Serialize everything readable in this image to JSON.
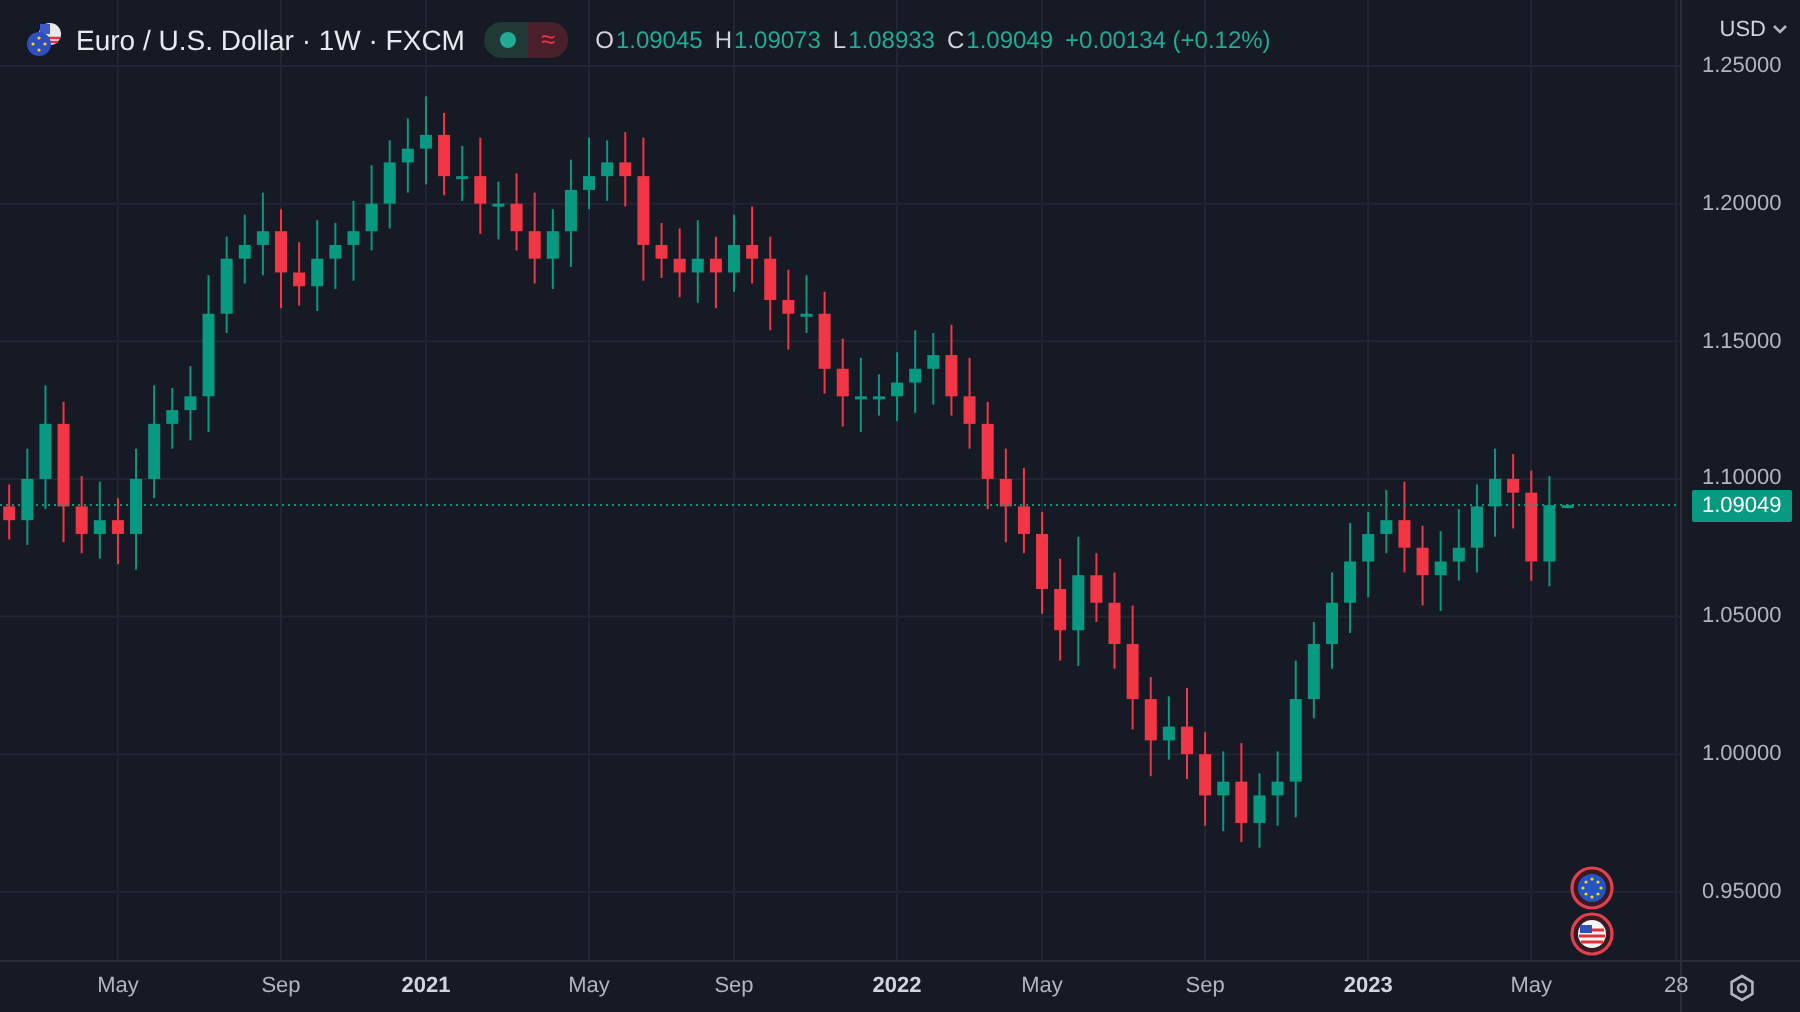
{
  "legend": {
    "symbol": "Euro / U.S. Dollar · 1W · FXCM",
    "status_badge": {
      "market_open": true,
      "symbol": "≈"
    },
    "ohlc": [
      {
        "label": "O",
        "value": "1.09045"
      },
      {
        "label": "H",
        "value": "1.09073"
      },
      {
        "label": "L",
        "value": "1.08933"
      },
      {
        "label": "C",
        "value": "1.09049"
      }
    ],
    "change": "+0.00134 (+0.12%)"
  },
  "price_axis": {
    "currency": "USD",
    "last_price": "1.09049"
  },
  "event_markers": [
    {
      "kind": "eu"
    },
    {
      "kind": "us"
    }
  ],
  "chart_data": {
    "type": "candlestick",
    "categories": [
      null,
      null,
      null,
      null,
      null,
      null,
      "May",
      null,
      null,
      null,
      null,
      null,
      null,
      null,
      null,
      "Sep",
      null,
      null,
      null,
      null,
      null,
      null,
      null,
      "2021",
      null,
      null,
      null,
      null,
      null,
      null,
      null,
      null,
      "May",
      null,
      null,
      null,
      null,
      null,
      null,
      null,
      "Sep",
      null,
      null,
      null,
      null,
      null,
      null,
      null,
      null,
      "2022",
      null,
      null,
      null,
      null,
      null,
      null,
      null,
      "May",
      null,
      null,
      null,
      null,
      null,
      null,
      null,
      null,
      "Sep",
      null,
      null,
      null,
      null,
      null,
      null,
      null,
      null,
      "2023",
      null,
      null,
      null,
      null,
      null,
      null,
      null,
      null,
      "May",
      null,
      null,
      null,
      null,
      null,
      null,
      null,
      "28"
    ],
    "ohlc": [
      [
        1.09,
        1.098,
        1.078,
        1.085
      ],
      [
        1.085,
        1.111,
        1.076,
        1.1
      ],
      [
        1.1,
        1.134,
        1.089,
        1.12
      ],
      [
        1.12,
        1.128,
        1.077,
        1.09
      ],
      [
        1.09,
        1.101,
        1.073,
        1.08
      ],
      [
        1.08,
        1.099,
        1.071,
        1.085
      ],
      [
        1.085,
        1.093,
        1.069,
        1.08
      ],
      [
        1.08,
        1.111,
        1.067,
        1.1
      ],
      [
        1.1,
        1.134,
        1.093,
        1.12
      ],
      [
        1.12,
        1.133,
        1.111,
        1.125
      ],
      [
        1.125,
        1.141,
        1.114,
        1.13
      ],
      [
        1.13,
        1.174,
        1.117,
        1.16
      ],
      [
        1.16,
        1.188,
        1.153,
        1.18
      ],
      [
        1.18,
        1.196,
        1.171,
        1.185
      ],
      [
        1.185,
        1.204,
        1.174,
        1.19
      ],
      [
        1.19,
        1.198,
        1.162,
        1.175
      ],
      [
        1.175,
        1.186,
        1.163,
        1.17
      ],
      [
        1.17,
        1.194,
        1.161,
        1.18
      ],
      [
        1.18,
        1.193,
        1.169,
        1.185
      ],
      [
        1.185,
        1.201,
        1.172,
        1.19
      ],
      [
        1.19,
        1.214,
        1.183,
        1.2
      ],
      [
        1.2,
        1.223,
        1.191,
        1.215
      ],
      [
        1.215,
        1.231,
        1.204,
        1.22
      ],
      [
        1.22,
        1.239,
        1.207,
        1.225
      ],
      [
        1.225,
        1.233,
        1.203,
        1.21
      ],
      [
        1.21,
        1.221,
        1.201,
        1.21
      ],
      [
        1.21,
        1.224,
        1.189,
        1.2
      ],
      [
        1.2,
        1.208,
        1.187,
        1.2
      ],
      [
        1.2,
        1.211,
        1.183,
        1.19
      ],
      [
        1.19,
        1.204,
        1.171,
        1.18
      ],
      [
        1.18,
        1.198,
        1.169,
        1.19
      ],
      [
        1.19,
        1.216,
        1.177,
        1.205
      ],
      [
        1.205,
        1.224,
        1.198,
        1.21
      ],
      [
        1.21,
        1.223,
        1.201,
        1.215
      ],
      [
        1.215,
        1.226,
        1.199,
        1.21
      ],
      [
        1.21,
        1.224,
        1.172,
        1.185
      ],
      [
        1.185,
        1.193,
        1.173,
        1.18
      ],
      [
        1.18,
        1.191,
        1.166,
        1.175
      ],
      [
        1.175,
        1.194,
        1.164,
        1.18
      ],
      [
        1.18,
        1.188,
        1.162,
        1.175
      ],
      [
        1.175,
        1.196,
        1.168,
        1.185
      ],
      [
        1.185,
        1.199,
        1.171,
        1.18
      ],
      [
        1.18,
        1.188,
        1.154,
        1.165
      ],
      [
        1.165,
        1.176,
        1.147,
        1.16
      ],
      [
        1.16,
        1.174,
        1.153,
        1.16
      ],
      [
        1.16,
        1.168,
        1.131,
        1.14
      ],
      [
        1.14,
        1.151,
        1.119,
        1.13
      ],
      [
        1.13,
        1.144,
        1.117,
        1.13
      ],
      [
        1.13,
        1.138,
        1.123,
        1.13
      ],
      [
        1.13,
        1.146,
        1.121,
        1.135
      ],
      [
        1.135,
        1.154,
        1.124,
        1.14
      ],
      [
        1.14,
        1.153,
        1.127,
        1.145
      ],
      [
        1.145,
        1.156,
        1.123,
        1.13
      ],
      [
        1.13,
        1.144,
        1.111,
        1.12
      ],
      [
        1.12,
        1.128,
        1.089,
        1.1
      ],
      [
        1.1,
        1.111,
        1.077,
        1.09
      ],
      [
        1.09,
        1.104,
        1.073,
        1.08
      ],
      [
        1.08,
        1.088,
        1.051,
        1.06
      ],
      [
        1.06,
        1.071,
        1.034,
        1.045
      ],
      [
        1.045,
        1.079,
        1.032,
        1.065
      ],
      [
        1.065,
        1.073,
        1.048,
        1.055
      ],
      [
        1.055,
        1.066,
        1.031,
        1.04
      ],
      [
        1.04,
        1.054,
        1.009,
        1.02
      ],
      [
        1.02,
        1.028,
        0.992,
        1.005
      ],
      [
        1.005,
        1.021,
        0.998,
        1.01
      ],
      [
        1.01,
        1.024,
        0.991,
        1.0
      ],
      [
        1.0,
        1.008,
        0.974,
        0.985
      ],
      [
        0.985,
        1.001,
        0.972,
        0.99
      ],
      [
        0.99,
        1.004,
        0.968,
        0.975
      ],
      [
        0.975,
        0.993,
        0.966,
        0.985
      ],
      [
        0.985,
        1.001,
        0.974,
        0.99
      ],
      [
        0.99,
        1.034,
        0.977,
        1.02
      ],
      [
        1.02,
        1.048,
        1.013,
        1.04
      ],
      [
        1.04,
        1.066,
        1.031,
        1.055
      ],
      [
        1.055,
        1.084,
        1.044,
        1.07
      ],
      [
        1.07,
        1.088,
        1.057,
        1.08
      ],
      [
        1.08,
        1.096,
        1.073,
        1.085
      ],
      [
        1.085,
        1.099,
        1.066,
        1.075
      ],
      [
        1.075,
        1.083,
        1.054,
        1.065
      ],
      [
        1.065,
        1.081,
        1.052,
        1.07
      ],
      [
        1.07,
        1.089,
        1.063,
        1.075
      ],
      [
        1.075,
        1.098,
        1.066,
        1.09
      ],
      [
        1.09,
        1.111,
        1.079,
        1.1
      ],
      [
        1.1,
        1.109,
        1.082,
        1.095
      ],
      [
        1.095,
        1.103,
        1.063,
        1.07
      ],
      [
        1.07,
        1.101,
        1.061,
        1.09045
      ],
      [
        1.09045,
        1.09073,
        1.08933,
        1.09049
      ],
      null,
      null,
      null,
      null,
      null,
      null
    ],
    "ylim": [
      0.9252,
      1.274
    ],
    "grid": true,
    "ref_lines": [
      {
        "axis": "y",
        "value": 1.09049,
        "color": "#089981"
      }
    ],
    "yticks": [
      {
        "value": 1.25,
        "label": "1.25000"
      },
      {
        "value": 1.2,
        "label": "1.20000"
      },
      {
        "value": 1.15,
        "label": "1.15000"
      },
      {
        "value": 1.1,
        "label": "1.10000"
      },
      {
        "value": 1.05,
        "label": "1.05000"
      },
      {
        "value": 1.0,
        "label": "1.00000"
      },
      {
        "value": 0.95,
        "label": "0.95000"
      }
    ]
  }
}
